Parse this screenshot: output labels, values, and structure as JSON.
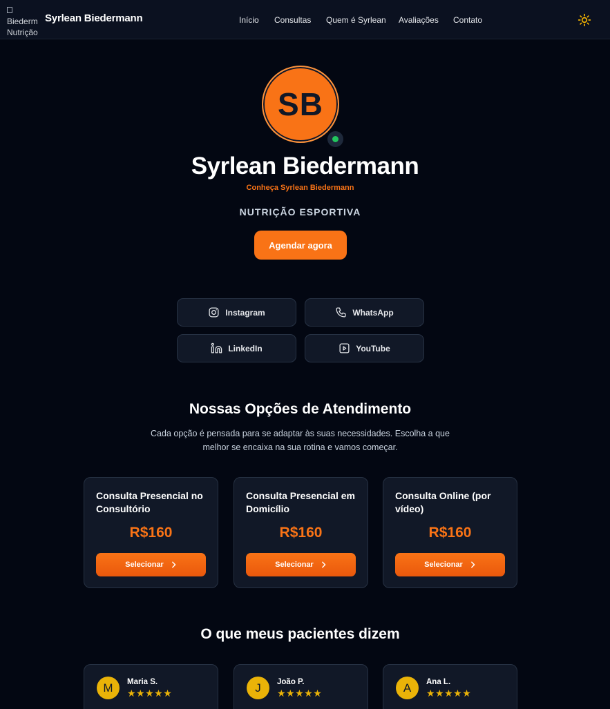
{
  "nav": {
    "logo_alt": "Biederm Nutrição",
    "brand": "Syrlean Biedermann",
    "links": [
      "Início",
      "Consultas",
      "Quem é Syrlean",
      "Avaliações",
      "Contato"
    ],
    "theme_icon": "sun-icon"
  },
  "hero": {
    "initials": "SB",
    "status": "online",
    "name": "Syrlean Biedermann",
    "subtitle": "Conheça Syrlean Biedermann",
    "tagline": "NUTRIÇÃO ESPORTIVA",
    "cta": "Agendar agora"
  },
  "social": [
    {
      "label": "Instagram",
      "icon": "instagram-icon"
    },
    {
      "label": "WhatsApp",
      "icon": "phone-icon"
    },
    {
      "label": "LinkedIn",
      "icon": "linkedin-icon"
    },
    {
      "label": "YouTube",
      "icon": "youtube-icon"
    }
  ],
  "services": {
    "title": "Nossas Opções de Atendimento",
    "description": "Cada opção é pensada para se adaptar às suas necessidades. Escolha a que melhor se encaixa na sua rotina e vamos começar.",
    "items": [
      {
        "title": "Consulta Presencial no Consultório",
        "price": "R$160",
        "button": "Selecionar"
      },
      {
        "title": "Consulta Presencial em Domicílio",
        "price": "R$160",
        "button": "Selecionar"
      },
      {
        "title": "Consulta Online (por vídeo)",
        "price": "R$160",
        "button": "Selecionar"
      }
    ]
  },
  "testimonials": {
    "title": "O que meus pacientes dizem",
    "items": [
      {
        "initial": "M",
        "name": "Maria S.",
        "stars": "★★★★★"
      },
      {
        "initial": "J",
        "name": "João P.",
        "stars": "★★★★★"
      },
      {
        "initial": "A",
        "name": "Ana L.",
        "stars": "★★★★★"
      }
    ]
  },
  "colors": {
    "accent": "#f97316",
    "background": "#030712",
    "card": "#111827",
    "star": "#eab308",
    "online": "#22c55e"
  }
}
